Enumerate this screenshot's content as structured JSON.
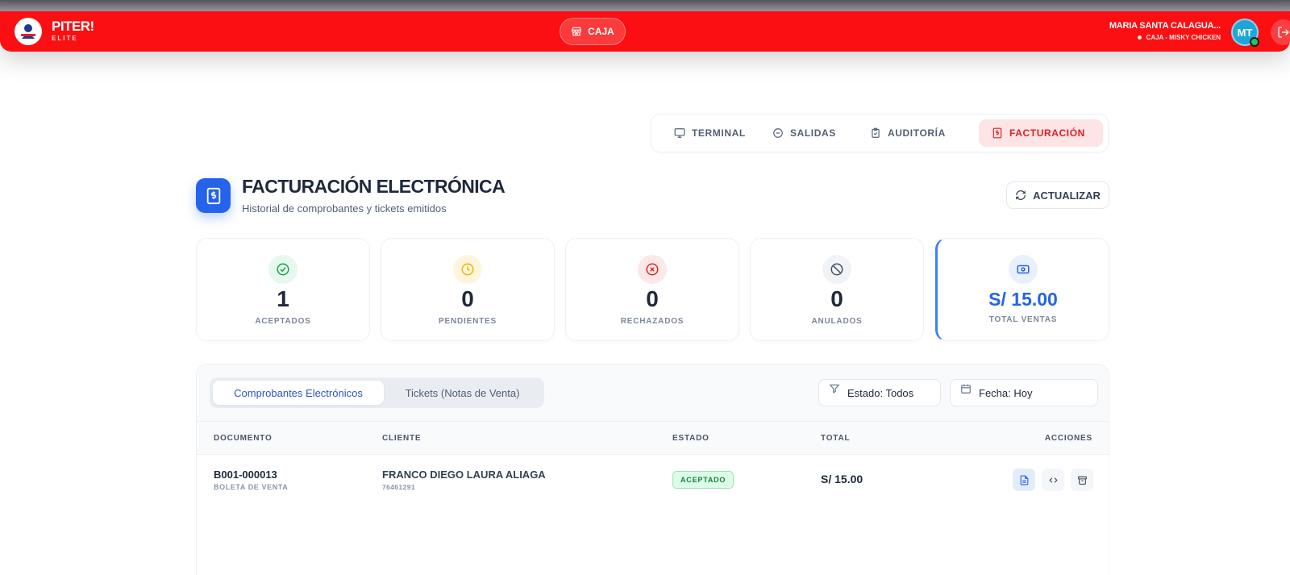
{
  "topbar": {
    "brand": "PITER!",
    "brand_sub": "ELITE",
    "center_button": "CAJA",
    "user_name": "MARIA SANTA CALAGUA...",
    "user_role": "CAJA - MISKY CHICKEN",
    "avatar_initials": "MT",
    "accent": "#fb0f12"
  },
  "navtabs": [
    {
      "label": "TERMINAL",
      "icon": "monitor-icon"
    },
    {
      "label": "SALIDAS",
      "icon": "minus-circle-icon"
    },
    {
      "label": "AUDITORÍA",
      "icon": "clipboard-icon"
    },
    {
      "label": "FACTURACIÓN",
      "icon": "invoice-icon",
      "active": true
    }
  ],
  "header": {
    "title": "FACTURACIÓN ELECTRÓNICA",
    "subtitle": "Historial de comprobantes y tickets emitidos",
    "refresh_label": "ACTUALIZAR"
  },
  "stats": [
    {
      "value": "1",
      "label": "ACEPTADOS",
      "icon": "check-circle-icon",
      "color": "#16a34a"
    },
    {
      "value": "0",
      "label": "PENDIENTES",
      "icon": "clock-icon",
      "color": "#eab308"
    },
    {
      "value": "0",
      "label": "RECHAZADOS",
      "icon": "x-circle-icon",
      "color": "#dc2626"
    },
    {
      "value": "0",
      "label": "ANULADOS",
      "icon": "ban-icon",
      "color": "#475569"
    },
    {
      "value": "S/ 15.00",
      "label": "TOTAL VENTAS",
      "icon": "banknote-icon",
      "color": "#2563eb"
    }
  ],
  "panel": {
    "tabs": [
      {
        "label": "Comprobantes Electrónicos",
        "active": true
      },
      {
        "label": "Tickets (Notas de Venta)",
        "active": false
      }
    ],
    "filter_estado": "Estado: Todos",
    "filter_fecha": "Fecha: Hoy",
    "columns": [
      "DOCUMENTO",
      "CLIENTE",
      "ESTADO",
      "TOTAL",
      "ACCIONES"
    ],
    "rows": [
      {
        "doc_number": "B001-000013",
        "doc_type": "BOLETA DE VENTA",
        "client_name": "FRANCO DIEGO LAURA ALIAGA",
        "client_id": "76461291",
        "status": "ACEPTADO",
        "total": "S/ 15.00",
        "actions": [
          "file-icon",
          "code-icon",
          "archive-icon"
        ]
      }
    ]
  }
}
